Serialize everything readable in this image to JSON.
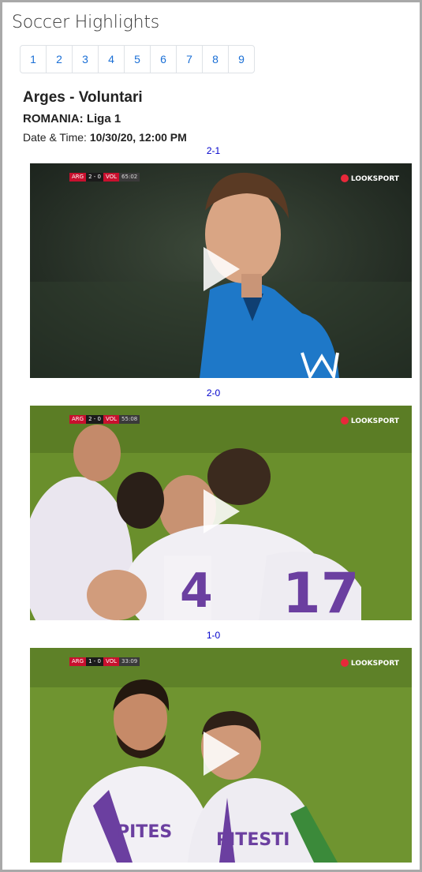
{
  "page": {
    "title": "Soccer Highlights"
  },
  "pagination": {
    "pages": [
      "1",
      "2",
      "3",
      "4",
      "5",
      "6",
      "7",
      "8",
      "9"
    ]
  },
  "match": {
    "title": "Arges - Voluntari",
    "league": "ROMANIA: Liga 1",
    "datetime_label": "Date & Time:",
    "datetime_value": "10/30/20, 12:00 PM"
  },
  "videos": [
    {
      "score_label": "2-1",
      "scorebug": {
        "home": "ARG",
        "score": "2 - 0",
        "away": "VOL",
        "clock": "65:02"
      },
      "broadcaster": "LOOKSPORT"
    },
    {
      "score_label": "2-0",
      "scorebug": {
        "home": "ARG",
        "score": "2 - 0",
        "away": "VOL",
        "clock": "55:08"
      },
      "broadcaster": "LOOKSPORT"
    },
    {
      "score_label": "1-0",
      "scorebug": {
        "home": "ARG",
        "score": "1 - 0",
        "away": "VOL",
        "clock": "33:09"
      },
      "broadcaster": "LOOKSPORT"
    }
  ],
  "colors": {
    "link": "#0000cc",
    "pagination_link": "#1a6fd6",
    "pitch": "#6a8f2c",
    "voluntari_blue": "#1e78c8",
    "arges_purple": "#6b3fa0"
  }
}
